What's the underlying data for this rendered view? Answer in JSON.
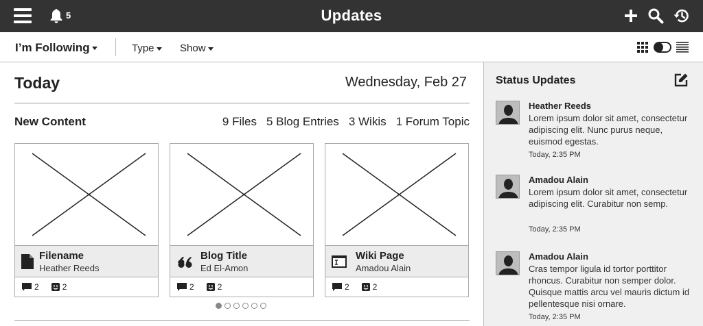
{
  "header": {
    "title": "Updates",
    "notification_count": "5"
  },
  "filters": {
    "following": "I’m Following",
    "type": "Type",
    "show": "Show"
  },
  "main": {
    "heading": "Today",
    "date": "Wednesday, Feb 27",
    "new_content": "New Content",
    "counts": [
      "9 Files",
      "5 Blog Entries",
      "3 Wikis",
      "1 Forum Topic"
    ],
    "cards": [
      {
        "title": "Filename",
        "author": "Heather Reeds",
        "icon": "file-icon",
        "comments": "2",
        "likes": "2"
      },
      {
        "title": "Blog Title",
        "author": "Ed El-Amon",
        "icon": "quote-icon",
        "comments": "2",
        "likes": "2"
      },
      {
        "title": "Wiki Page",
        "author": "Amadou Alain",
        "icon": "wiki-icon",
        "comments": "2",
        "likes": "2"
      }
    ],
    "carousel": {
      "pages": 6,
      "active": 1
    }
  },
  "sidebar": {
    "title": "Status Updates",
    "updates": [
      {
        "name": "Heather Reeds",
        "text": "Lorem ipsum dolor sit amet, consectetur adipiscing elit. Nunc purus neque, euismod egestas.",
        "time": "Today, 2:35 PM"
      },
      {
        "name": "Amadou Alain",
        "text": "Lorem ipsum dolor sit amet, consectetur adipiscing elit. Curabitur non semp.",
        "time": "Today, 2:35 PM"
      },
      {
        "name": "Amadou Alain",
        "text": "Cras tempor ligula id tortor porttitor rhoncus. Curabitur non semper dolor. Quisque mattis arcu vel mauris dictum id pellentesque nisi ornare.",
        "time": "Today, 2:35 PM"
      }
    ]
  }
}
